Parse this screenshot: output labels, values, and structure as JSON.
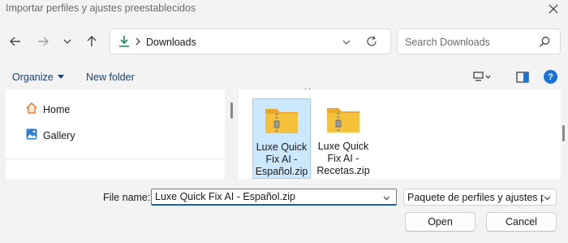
{
  "window": {
    "title": "Importar perfiles y ajustes preestablecidos"
  },
  "nav": {
    "back_icon": "arrow-left-icon",
    "forward_icon": "arrow-right-icon",
    "recent_icon": "chevron-down-icon",
    "up_icon": "arrow-up-icon"
  },
  "address": {
    "location_icon": "download-icon",
    "path": "Downloads"
  },
  "search": {
    "placeholder": "Search Downloads"
  },
  "toolbar": {
    "organize_label": "Organize",
    "new_folder_label": "New folder",
    "help_label": "?"
  },
  "sidebar": {
    "items": [
      {
        "label": "Home",
        "icon": "home-icon"
      },
      {
        "label": "Gallery",
        "icon": "gallery-icon"
      }
    ]
  },
  "files": [
    {
      "name_lines": [
        "Luxe Quick",
        "Fix AI -",
        "Español.zip"
      ],
      "icon": "zip-folder-icon",
      "selected": true
    },
    {
      "name_lines": [
        "Luxe Quick",
        "Fix AI -",
        "Recetas.zip"
      ],
      "icon": "zip-folder-icon",
      "selected": false
    }
  ],
  "footer": {
    "file_name_label": "File name:",
    "file_name_value": "Luxe Quick Fix AI - Español.zip",
    "file_type_value": "Paquete de perfiles y ajustes pre",
    "open_label": "Open",
    "cancel_label": "Cancel"
  },
  "colors": {
    "accent": "#1a73d9",
    "selection_bg": "#cce8ff",
    "download_green": "#1b8a5a",
    "folder_yellow": "#f5c13b"
  }
}
